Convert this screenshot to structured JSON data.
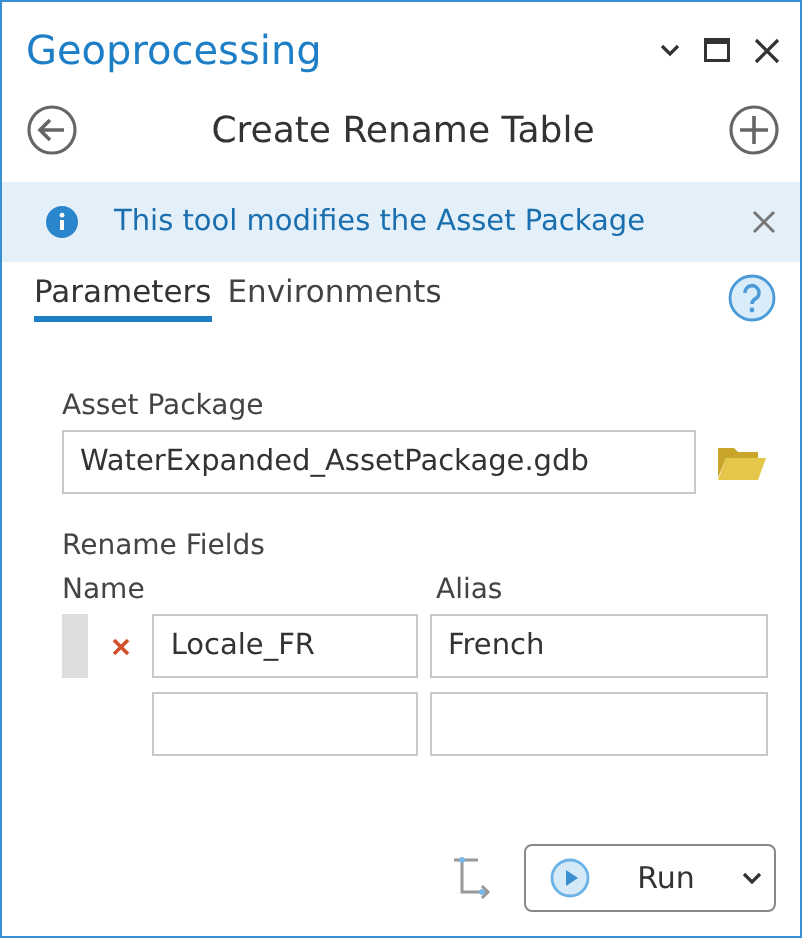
{
  "window": {
    "title": "Geoprocessing"
  },
  "tool": {
    "title": "Create Rename Table"
  },
  "banner": {
    "message": "This tool modifies the Asset Package"
  },
  "tabs": [
    {
      "label": "Parameters",
      "selected": true
    },
    {
      "label": "Environments",
      "selected": false
    }
  ],
  "asset_package": {
    "label": "Asset Package",
    "value": "WaterExpanded_AssetPackage.gdb"
  },
  "rename_fields": {
    "label": "Rename Fields",
    "columns": [
      "Name",
      "Alias"
    ],
    "rows": [
      {
        "kind": "entry",
        "name": "Locale_FR",
        "alias": "French"
      },
      {
        "kind": "blank"
      }
    ]
  },
  "run_button": {
    "label": "Run"
  }
}
